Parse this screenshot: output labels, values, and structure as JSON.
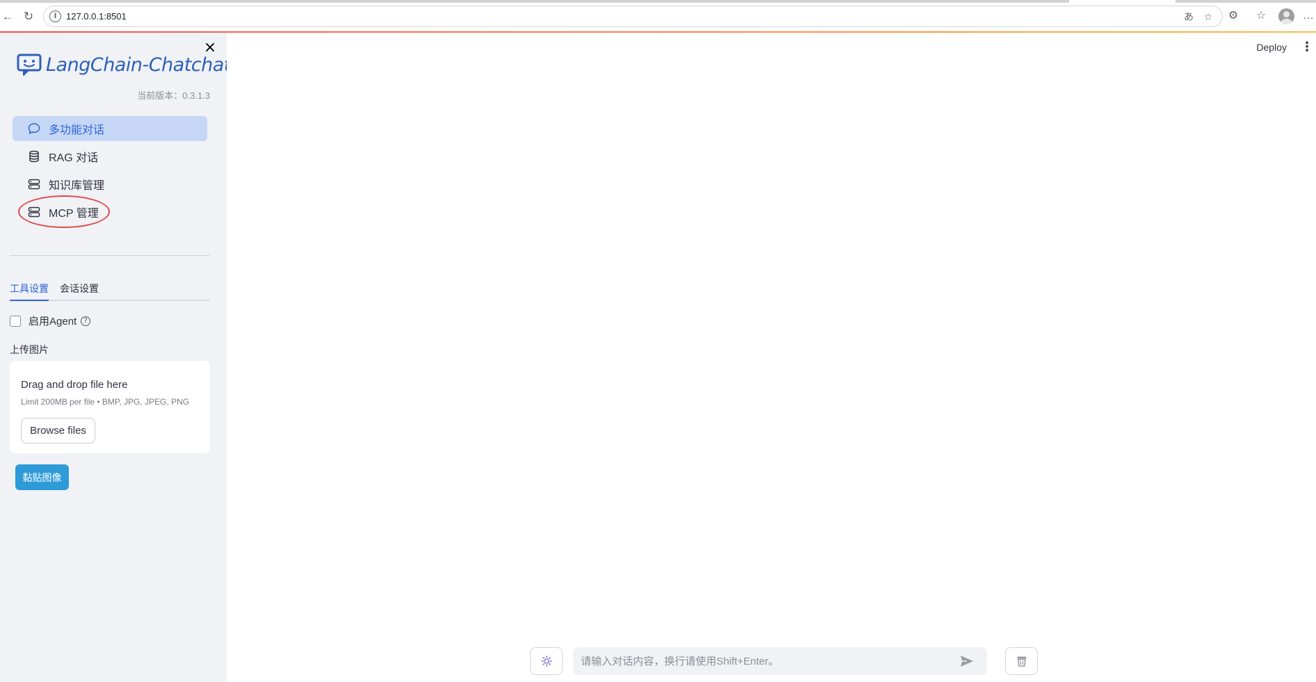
{
  "browser": {
    "url": "127.0.0.1:8501"
  },
  "sidebar": {
    "logo_text": "LangChain-Chatchat",
    "version": "当前版本：0.3.1.3",
    "menu": [
      {
        "label": "多功能对话",
        "icon": "chat-bubble-icon",
        "active": true
      },
      {
        "label": "RAG 对话",
        "icon": "database-icon",
        "active": false
      },
      {
        "label": "知识库管理",
        "icon": "server-icon",
        "active": false
      },
      {
        "label": "MCP 管理",
        "icon": "server-icon",
        "active": false
      }
    ],
    "tabs": [
      "工具设置",
      "会话设置"
    ],
    "agent_label": "启用Agent",
    "agent_checked": false,
    "upload_label": "上传图片",
    "dropzone_title": "Drag and drop file here",
    "dropzone_limit": "Limit 200MB per file • BMP, JPG, JPEG, PNG",
    "browse_label": "Browse files",
    "paste_label": "黏贴图像"
  },
  "main": {
    "deploy_label": "Deploy",
    "chat_placeholder": "请输入对话内容，换行请使用Shift+Enter。"
  },
  "colors": {
    "accent": "#2c64d8",
    "active_menu_bg": "#c6d7f5",
    "highlight_circle": "#e04848",
    "paste_button": "#2e9bd8"
  }
}
